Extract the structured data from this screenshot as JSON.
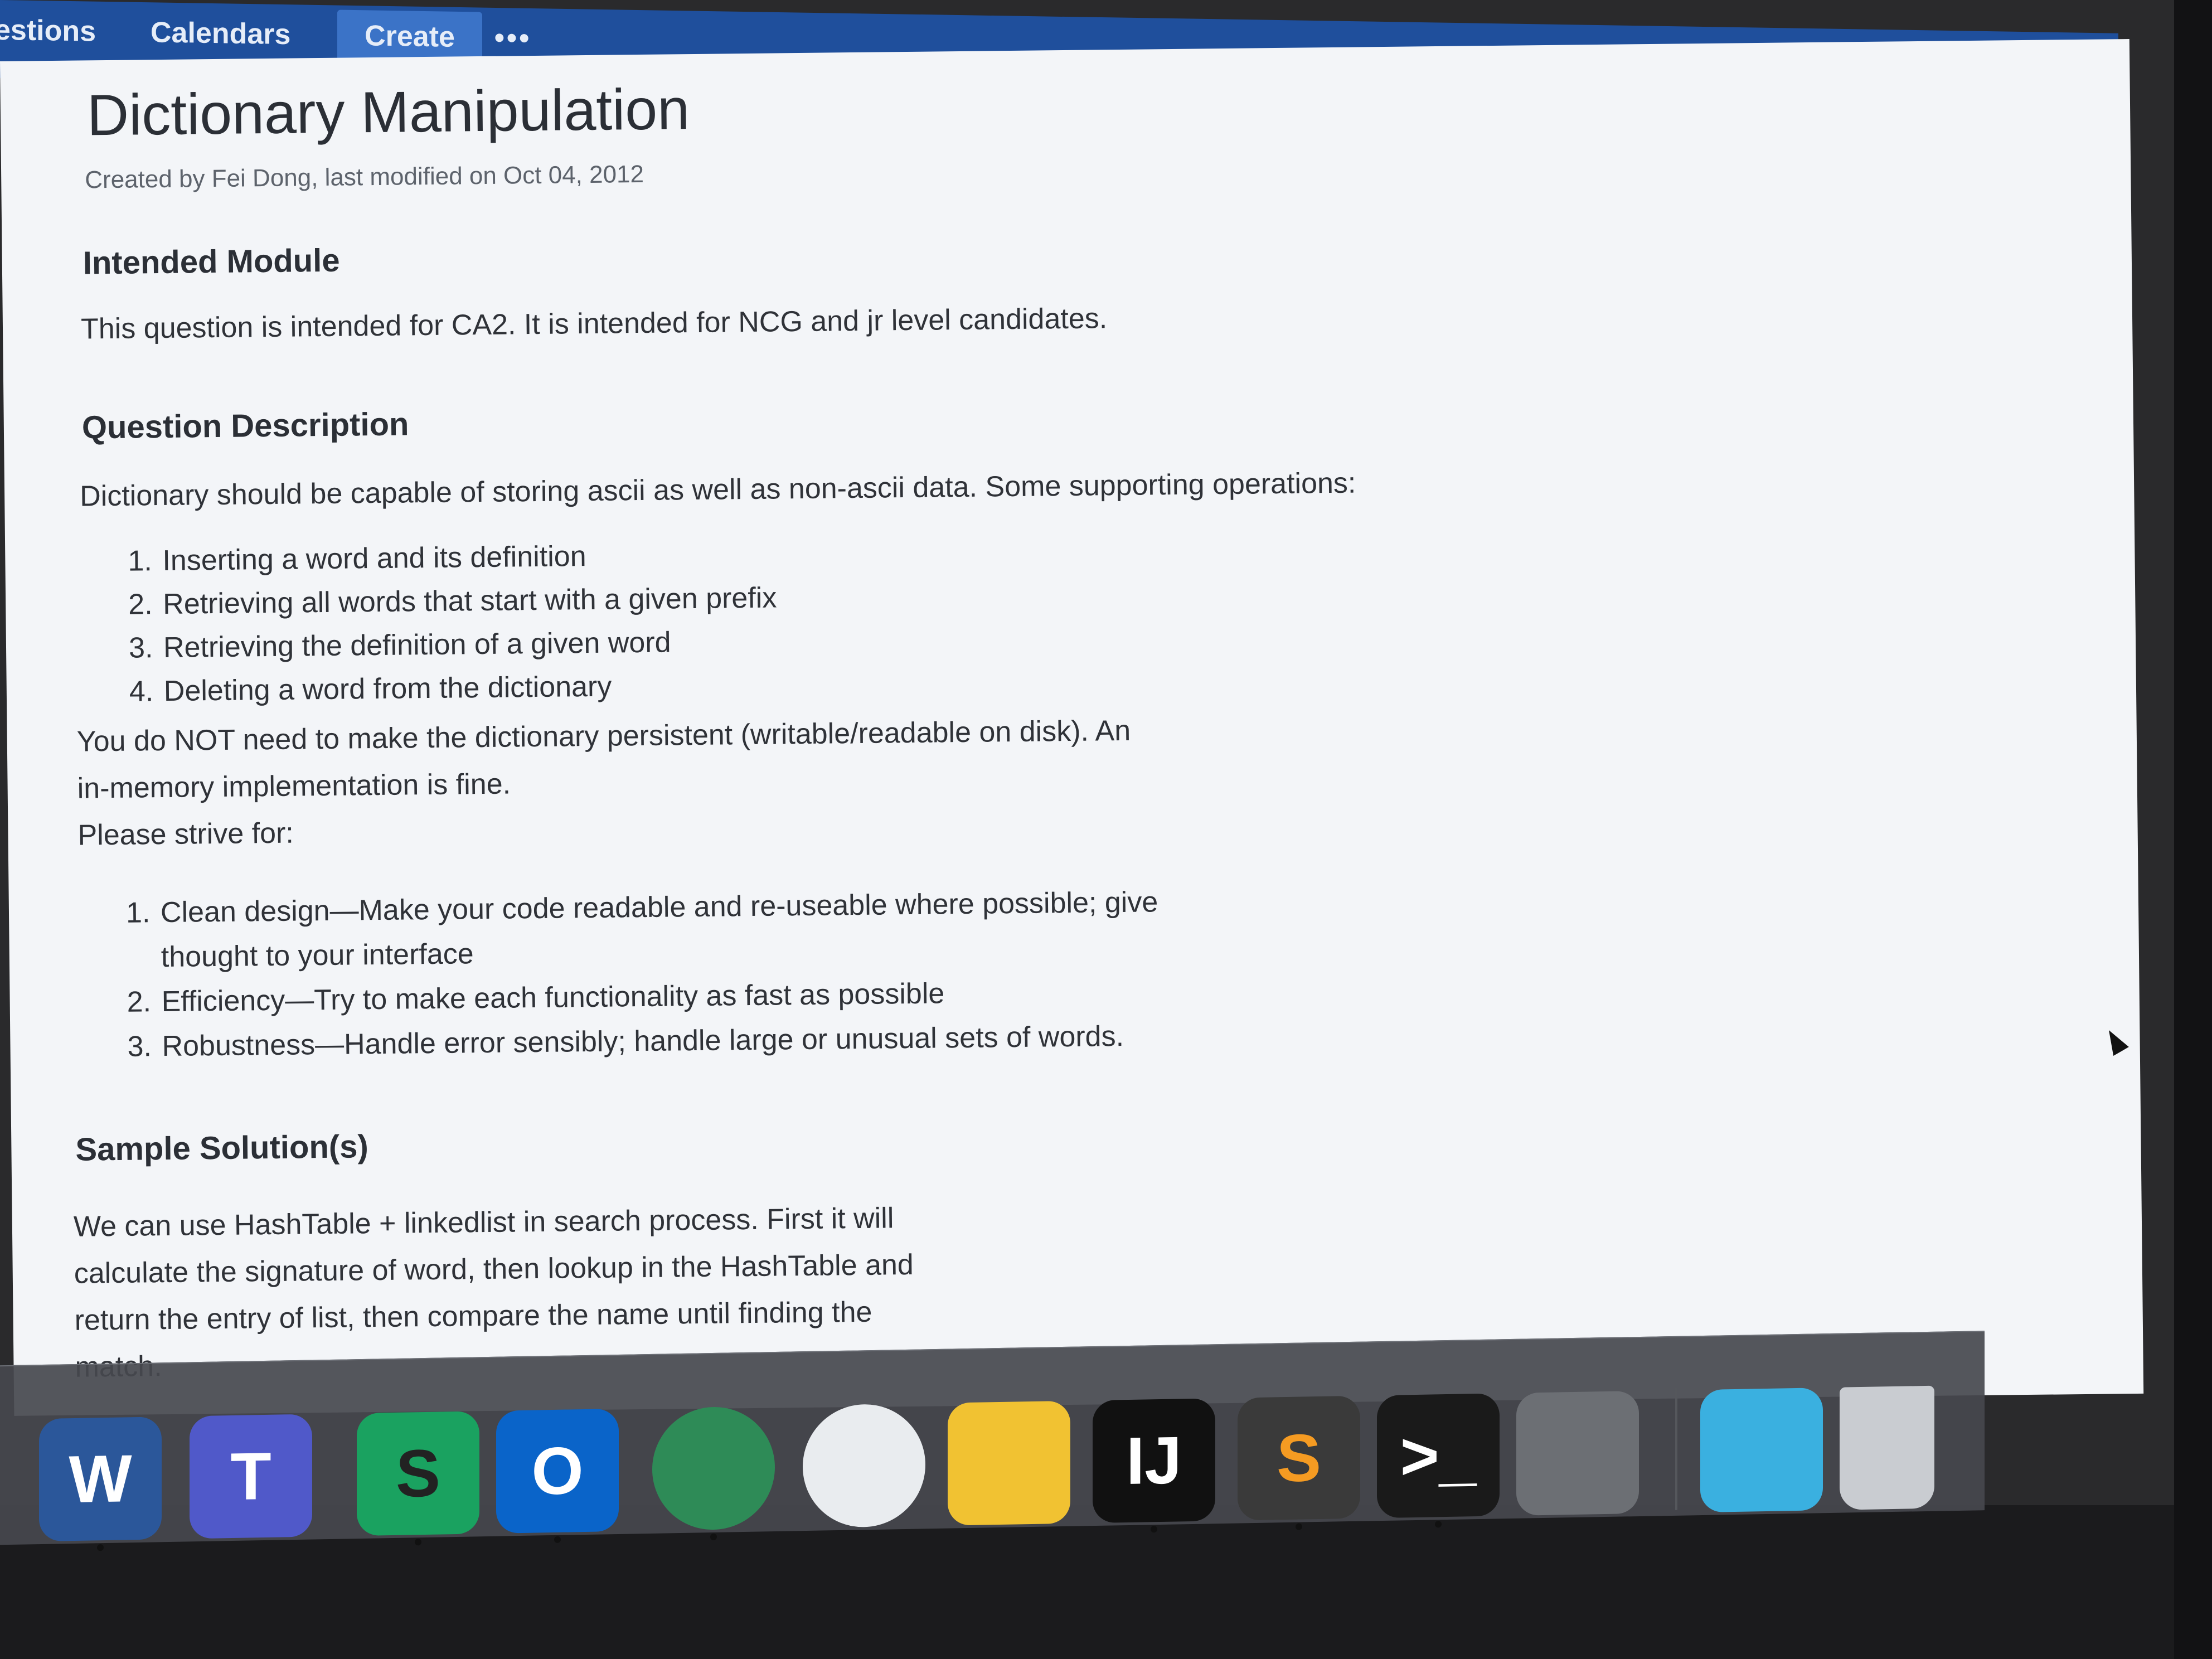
{
  "topnav": {
    "items": [
      "estions",
      "Calendars"
    ],
    "create_label": "Create",
    "more_label": "•••"
  },
  "page": {
    "title": "Dictionary Manipulation",
    "byline": "Created by Fei Dong, last modified on Oct 04, 2012",
    "sections": {
      "module": {
        "heading": "Intended Module",
        "text": "This question is intended for CA2.  It is intended for NCG and jr level candidates."
      },
      "description": {
        "heading": "Question Description",
        "text": "Dictionary should be capable of storing ascii as well as non-ascii data. Some supporting operations:",
        "operations": [
          "Inserting a word and its definition",
          "Retrieving all words that start with a given prefix",
          "Retrieving the definition of a given word",
          "Deleting a word from the dictionary"
        ],
        "persist_line1": "You do NOT need to make the dictionary persistent (writable/readable on disk). An",
        "persist_line2": "in-memory implementation is fine.",
        "strive_intro": "Please strive for:",
        "strive": [
          {
            "line1": "Clean design—Make your code readable and re-useable where possible; give",
            "line2": "thought to your interface"
          },
          {
            "line1": "Efficiency—Try to make each functionality as fast as possible"
          },
          {
            "line1": "Robustness—Handle error sensibly; handle large or unusual sets of words."
          }
        ]
      },
      "sample": {
        "heading": "Sample Solution(s)",
        "lines": [
          "We can use HashTable + linkedlist in search process. First it will",
          "calculate the signature of word, then lookup in the HashTable and",
          "return the entry of list, then compare the name until finding the",
          "match."
        ]
      }
    }
  },
  "dock": {
    "apps": [
      {
        "icon": "word-icon",
        "letter": "W",
        "color": "#2b579a"
      },
      {
        "icon": "teams-icon",
        "letter": "T",
        "color": "#5059c9"
      },
      {
        "icon": "skype-business-icon",
        "letter": "S",
        "color": "#1aa260"
      },
      {
        "icon": "outlook-icon",
        "letter": "O",
        "color": "#0a64c9"
      },
      {
        "icon": "vpn-icon",
        "letter": "",
        "color": "#2e8b57"
      },
      {
        "icon": "wifi-icon",
        "letter": "",
        "color": "#e9ecef"
      },
      {
        "icon": "launchpad-icon",
        "letter": "",
        "color": "#f1c232"
      },
      {
        "icon": "intellij-icon",
        "letter": "IJ",
        "color": "#111111"
      },
      {
        "icon": "sublime-icon",
        "letter": "S",
        "color": "#3a3a3a"
      },
      {
        "icon": "terminal-icon",
        "letter": ">_",
        "color": "#1a1a1a"
      },
      {
        "icon": "system-prefs-icon",
        "letter": "",
        "color": "#6c6f74"
      },
      {
        "icon": "downloads-folder-icon",
        "letter": "",
        "color": "#3ab0e0"
      },
      {
        "icon": "trash-icon",
        "letter": "",
        "color": "#c9ccd1"
      }
    ]
  }
}
